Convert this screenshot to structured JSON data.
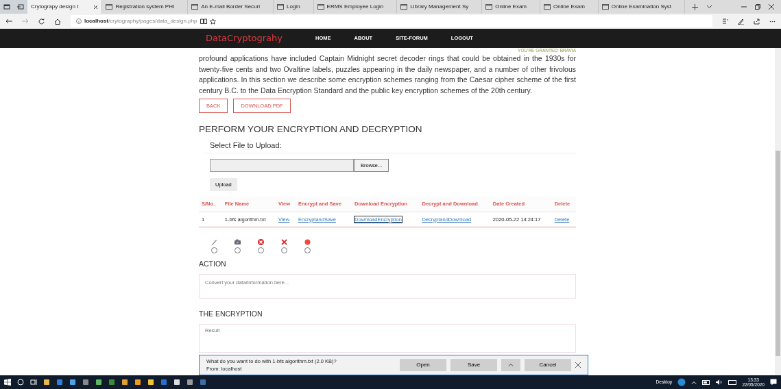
{
  "browser": {
    "tabs": [
      {
        "title": "Crytograpy design t",
        "selected": true
      },
      {
        "title": "Registration system PHI",
        "selected": false
      },
      {
        "title": "An E-mail Border Securi",
        "selected": false
      },
      {
        "title": "Login",
        "selected": false
      },
      {
        "title": "ERMS Employee Login",
        "selected": false
      },
      {
        "title": "Library Management Sy",
        "selected": false
      },
      {
        "title": "Online Exam",
        "selected": false
      },
      {
        "title": "Online Exam",
        "selected": false
      },
      {
        "title": "Online Examination Syst",
        "selected": false
      }
    ],
    "address": {
      "host": "localhost",
      "path": "/crytography/pages/data_design.php"
    }
  },
  "site": {
    "brand": "DataCryptograhy",
    "nav": [
      "HOME",
      "ABOUT",
      "SITE-FORUM",
      "LOGOUT"
    ]
  },
  "granted": "YOU'RE GRANTED: BRAVIA",
  "paragraph": "profound applications have included Captain Midnight secret decoder rings that could be obtained in the 1930s for twenty-five cents and two Ovaltine labels, puzzles appearing in the daily newspaper, and a number of other frivolous applications. In this section we describe some encryption schemes ranging from the Caesar cipher scheme of the first century B.C. to the Data Encryption Standard and the public key encryption schemes of the 20th century.",
  "page_buttons": [
    "BACK",
    "DOWNLOAD PDF"
  ],
  "section_title": "PERFORM YOUR ENCRYPTION AND DECRYPTION",
  "upload": {
    "label": "Select File to Upload:",
    "browse": "Browse...",
    "submit": "Upload"
  },
  "table": {
    "columns": [
      "S/No_",
      "File Name",
      "View",
      "Encrypt and Save",
      "Download Encryption",
      "Decrypt and Download",
      "Date Created",
      "Delete"
    ],
    "rows": [
      [
        {
          "text": "1",
          "kind": "text"
        },
        {
          "text": "1-bfs algorithm.txt",
          "kind": "text"
        },
        {
          "text": "View",
          "kind": "link"
        },
        {
          "text": "EncryptandSave",
          "kind": "link"
        },
        {
          "text": "DownloadEncryption",
          "kind": "link",
          "focused": true
        },
        {
          "text": "DecryptandDownload",
          "kind": "link"
        },
        {
          "text": "2020-05-22 14:24:17",
          "kind": "text"
        },
        {
          "text": "Delete",
          "kind": "link"
        }
      ]
    ]
  },
  "options": [
    {
      "kind": "pencil",
      "selected": false
    },
    {
      "kind": "camera",
      "selected": false
    },
    {
      "kind": "error",
      "selected": false
    },
    {
      "kind": "cross",
      "selected": false
    },
    {
      "kind": "dot",
      "selected": false
    }
  ],
  "action": {
    "title": "ACTION",
    "placeholder": "Convert your data/information here..."
  },
  "encryption": {
    "title": "THE ENCRYPTION",
    "placeholder": "Result"
  },
  "download_bar": {
    "message": "What do you want to do with 1-bfs algorithm.txt (2.0 KB)?",
    "from": "From: localhost",
    "buttons": [
      "Open",
      "Save",
      "Cancel"
    ]
  },
  "taskbar": {
    "desktop": "Desktop",
    "time": "13:33",
    "date": "22/05/2020"
  }
}
